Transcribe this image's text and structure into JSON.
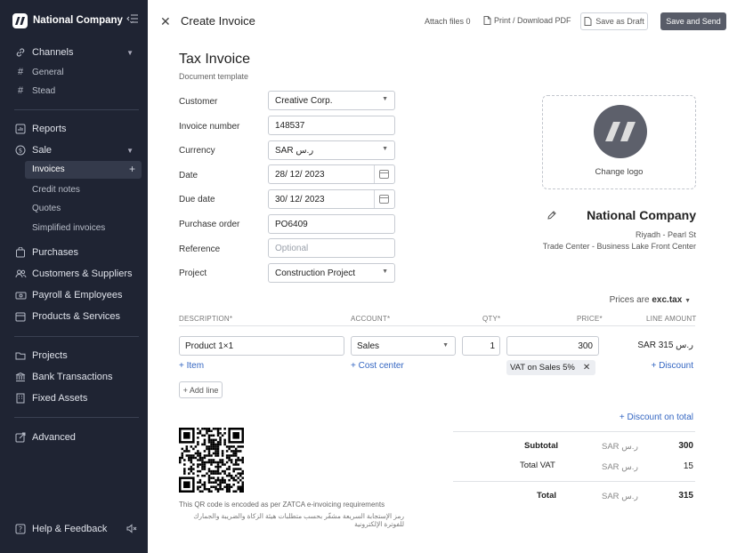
{
  "sidebar": {
    "company": "National Company",
    "items": {
      "channels": "Channels",
      "general": "General",
      "stead": "Stead",
      "reports": "Reports",
      "sale": "Sale",
      "invoices": "Invoices",
      "credit_notes": "Credit notes",
      "quotes": "Quotes",
      "simplified_invoices": "Simplified invoices",
      "purchases": "Purchases",
      "customers_suppliers": "Customers & Suppliers",
      "payroll": "Payroll & Employees",
      "products": "Products & Services",
      "projects": "Projects",
      "bank": "Bank Transactions",
      "assets": "Fixed Assets",
      "advanced": "Advanced",
      "help": "Help & Feedback"
    }
  },
  "topbar": {
    "title": "Create Invoice",
    "attach": "Attach files 0",
    "print": "Print / Download PDF",
    "draft": "Save as Draft",
    "send": "Save and Send"
  },
  "doc": {
    "title": "Tax Invoice",
    "subtitle": "Document template"
  },
  "form": {
    "customer": {
      "label": "Customer",
      "value": "Creative Corp."
    },
    "invoice_number": {
      "label": "Invoice number",
      "value": "148537"
    },
    "currency": {
      "label": "Currency",
      "value": "SAR ر.س"
    },
    "date": {
      "label": "Date",
      "value": "28/ 12/ 2023"
    },
    "due_date": {
      "label": "Due date",
      "value": "30/ 12/ 2023"
    },
    "purchase_order": {
      "label": "Purchase order",
      "value": "PO6409"
    },
    "reference": {
      "label": "Reference",
      "placeholder": "Optional"
    },
    "project": {
      "label": "Project",
      "value": "Construction Project"
    }
  },
  "logo": {
    "change": "Change logo"
  },
  "company": {
    "name": "National Company",
    "address1": "Riyadh - Pearl St",
    "address2": "Trade Center - Business Lake Front Center"
  },
  "prices": {
    "prefix": "Prices are",
    "mode": "exc.tax"
  },
  "table": {
    "headers": {
      "description": "DESCRIPTION*",
      "account": "ACCOUNT*",
      "qty": "QTY*",
      "price": "PRICE*",
      "amount": "LINE AMOUNT"
    },
    "line": {
      "description": "Product 1×1",
      "account": "Sales",
      "qty": "1",
      "price": "300",
      "amount": "SAR ر.س 315",
      "vat": "VAT on Sales 5%"
    },
    "add_item": "+ Item",
    "add_cost_center": "+ Cost center",
    "add_discount": "+ Discount",
    "add_line": "+ Add line",
    "discount_total": "+ Discount on total"
  },
  "totals": {
    "currency": "SAR ر.س",
    "subtotal_label": "Subtotal",
    "subtotal": "300",
    "vat_label": "Total VAT",
    "vat": "15",
    "total_label": "Total",
    "total": "315"
  },
  "qr": {
    "note": "This QR code is encoded as per ZATCA e-invoicing requirements",
    "note_ar": "رمز الإستجابة السريعة مشفّر بحسب متطلبات هيئة الزكاة والضريبة والجمارك للفوترة الإلكترونية"
  }
}
